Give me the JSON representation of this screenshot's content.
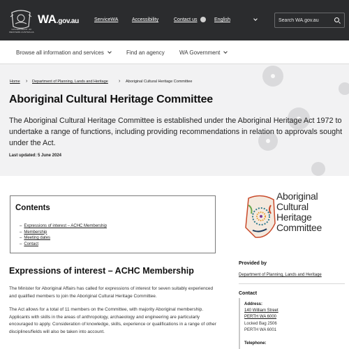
{
  "header": {
    "crest_caption": "GOVERNMENT OF WESTERN AUSTRALIA",
    "logo_main": "WA",
    "logo_suffix": ".gov.au",
    "links": [
      "ServiceWA",
      "Accessibility",
      "Contact us"
    ],
    "language": "English",
    "search_placeholder": "Search WA.gov.au"
  },
  "subnav": {
    "items": [
      "Browse all information and services",
      "Find an agency",
      "WA Government"
    ]
  },
  "breadcrumb": [
    "Home",
    "Department of Planning, Lands and Heritage",
    "Aboriginal Cultural Heritage Committee"
  ],
  "page": {
    "title": "Aboriginal Cultural Heritage Committee",
    "intro": "The Aboriginal Cultural Heritage Committee is established under the Aboriginal Heritage Act 1972 to undertake a range of functions, including providing recommendations in relation to approvals sought under the Act.",
    "last_updated": "Last updated: 5 June 2024"
  },
  "contents": {
    "heading": "Contents",
    "items": [
      "Expressions of interest – ACHC Membership",
      "Membership",
      "Meeting dates",
      "Contact"
    ]
  },
  "section": {
    "title": "Expressions of interest – ACHC Membership",
    "paragraphs": [
      "The Minister for Aboriginal Affairs has called for expressions of interest for seven suitably experienced and qualified members to join the Aboriginal Cultural Heritage Committee.",
      "The Act allows for a total of 11 members on the Committee, with majority Aboriginal membership. Applicants with skills in the areas of anthropology, archaeology and engineering are particularly encouraged to apply. Consideration of knowledge, skills, experience or qualifications in a range of other disciplines/fields will also be taken into account."
    ]
  },
  "sidebar": {
    "logo_text": "Aboriginal\nCultural\nHeritage\nCommittee",
    "provided_by_heading": "Provided by",
    "provided_by": "Department of Planning, Lands and Heritage",
    "contact_heading": "Contact",
    "address_label": "Address:",
    "address_lines": [
      "140 William Street",
      "PERTH WA 6000",
      "Locked Bag 2506",
      "PERTH WA 6001"
    ],
    "telephone_label": "Telephone:"
  },
  "colors": {
    "header_bg": "#2b2c2e",
    "hero_bg": "#f2f2f3",
    "logo_palette": [
      "#c94a2a",
      "#e89a2a",
      "#2f7a8c",
      "#6aa84f",
      "#7d3c98",
      "#1b3a5c"
    ]
  }
}
